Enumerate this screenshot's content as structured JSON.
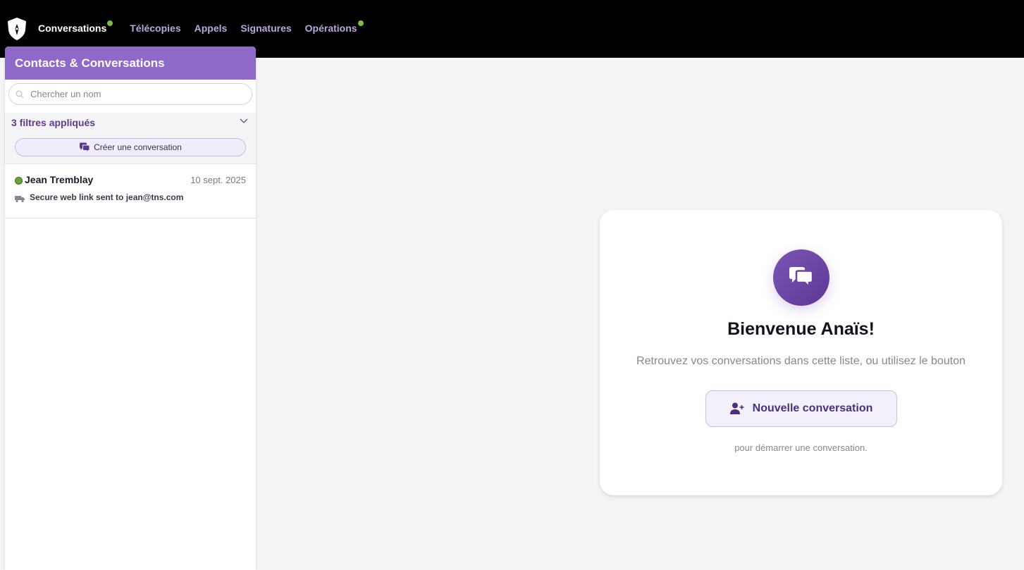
{
  "nav": {
    "items": [
      {
        "label": "Conversations",
        "active": true,
        "dot": true
      },
      {
        "label": "Télécopies",
        "active": false,
        "dot": false
      },
      {
        "label": "Appels",
        "active": false,
        "dot": false
      },
      {
        "label": "Signatures",
        "active": false,
        "dot": false
      },
      {
        "label": "Opérations",
        "active": false,
        "dot": true
      }
    ]
  },
  "sidebar": {
    "title": "Contacts & Conversations",
    "search_placeholder": "Chercher un nom",
    "filters_label": "3 filtres appliqués",
    "create_label": "Créer une conversation",
    "conversations": [
      {
        "name": "Jean Tremblay",
        "date": "10 sept. 2025",
        "last_message": "Secure web link sent to jean@tns.com",
        "status": "online"
      }
    ]
  },
  "welcome": {
    "title": "Bienvenue Anaïs!",
    "subtitle": "Retrouvez vos conversations dans cette liste, ou utilisez le bouton",
    "button_label": "Nouvelle conversation",
    "footer": "pour démarrer une conversation."
  },
  "colors": {
    "accent": "#8f69c8",
    "dark_accent": "#5e3696",
    "status_online": "#6aa33a",
    "nav_dot": "#7cc043"
  },
  "icons": [
    "shield-logo-icon",
    "search-icon",
    "chevron-down-icon",
    "chat-bubbles-icon",
    "truck-icon",
    "add-user-icon"
  ]
}
